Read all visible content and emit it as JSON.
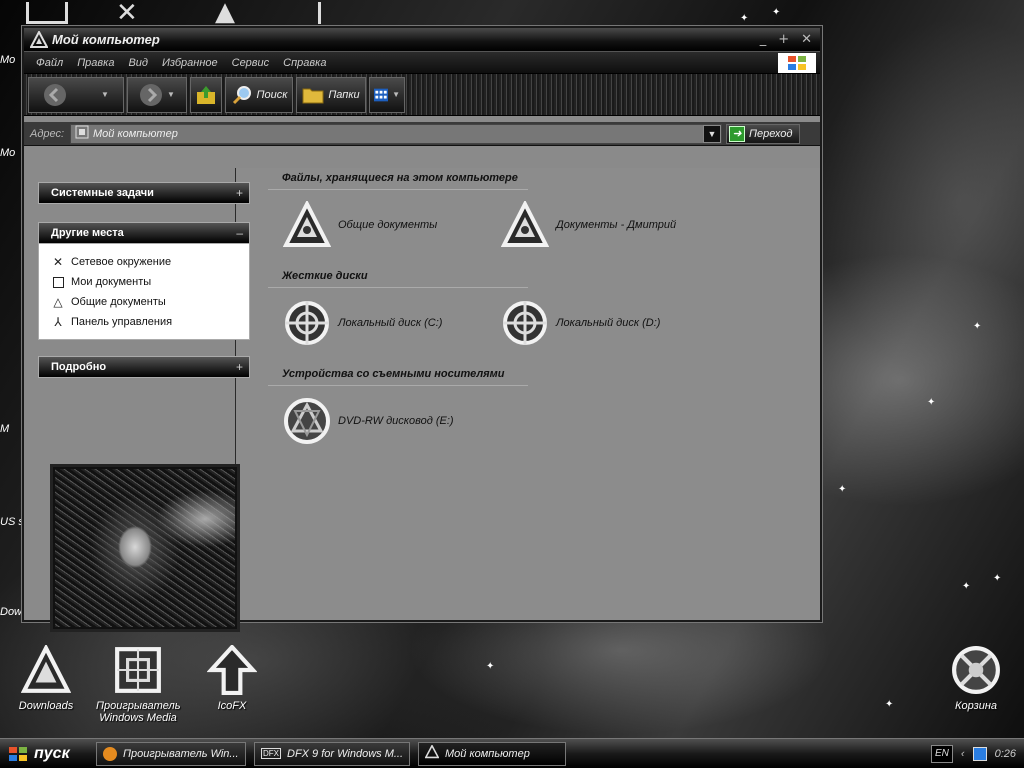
{
  "window": {
    "title": "Мой компьютер",
    "controls": [
      "_",
      "+",
      "✕"
    ]
  },
  "menu": [
    "Файл",
    "Правка",
    "Вид",
    "Избранное",
    "Сервис",
    "Справка"
  ],
  "toolbar": {
    "search_label": "Поиск",
    "folders_label": "Папки"
  },
  "address": {
    "label": "Адрес:",
    "value": "Мой компьютер",
    "go_label": "Переход"
  },
  "sidebar": {
    "system_tasks": "Системные задачи",
    "other_places": "Другие места",
    "places": [
      {
        "label": "Сетевое окружение",
        "icon": "network-icon"
      },
      {
        "label": "Мои документы",
        "icon": "my-documents-icon"
      },
      {
        "label": "Общие документы",
        "icon": "shared-documents-icon"
      },
      {
        "label": "Панель управления",
        "icon": "control-panel-icon"
      }
    ],
    "details": "Подробно"
  },
  "groups": {
    "files": "Файлы, хранящиеся на этом компьютере",
    "drives": "Жесткие диски",
    "removable": "Устройства со съемными носителями"
  },
  "items": {
    "shared_docs": "Общие документы",
    "user_docs": "Документы - Дмитрий",
    "disk_c": "Локальный диск (C:)",
    "disk_d": "Локальный диск (D:)",
    "dvd": "DVD-RW дисковод (E:)"
  },
  "desktop": {
    "downloads": "Downloads",
    "wmp": "Проигрыватель Windows Media",
    "icofx": "IcoFX",
    "recycle": "Корзина",
    "left_labels": [
      "Мо",
      "Мо",
      "М",
      "US sb",
      "Dow"
    ]
  },
  "taskbar": {
    "start": "пуск",
    "tasks": [
      "Проигрыватель Win...",
      "DFX 9 for Windows M...",
      "Мой компьютер"
    ],
    "lang": "EN",
    "clock": "0:26"
  }
}
